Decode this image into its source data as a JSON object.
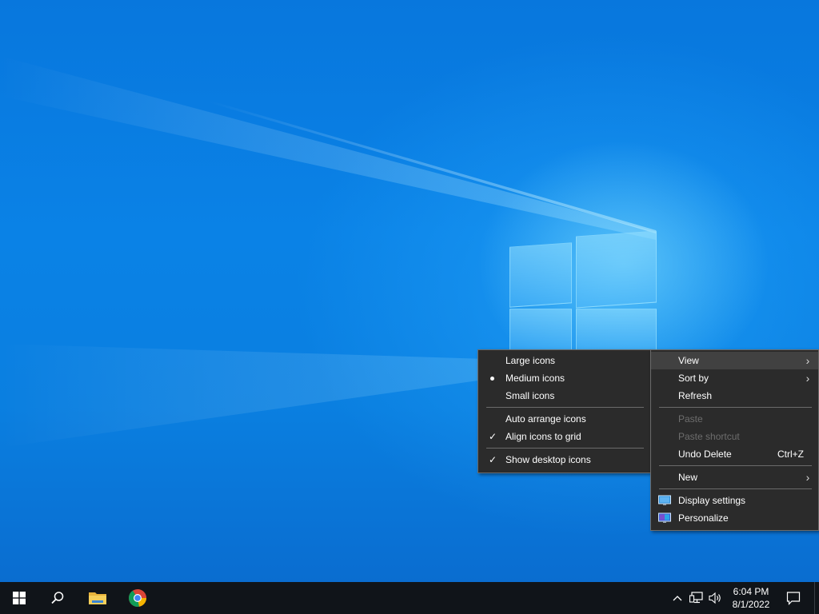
{
  "desktop": {
    "wallpaper": "windows-10-hero-wallpaper"
  },
  "view_submenu": {
    "items": [
      {
        "label": "Large icons",
        "mark": ""
      },
      {
        "label": "Medium icons",
        "mark": "bullet"
      },
      {
        "label": "Small icons",
        "mark": ""
      },
      {
        "label": "Auto arrange icons",
        "mark": ""
      },
      {
        "label": "Align icons to grid",
        "mark": "check"
      },
      {
        "label": "Show desktop icons",
        "mark": "check"
      }
    ],
    "check_glyph": "✓"
  },
  "context_menu": {
    "view": {
      "label": "View",
      "has_submenu": true,
      "highlighted": true
    },
    "sort_by": {
      "label": "Sort by",
      "has_submenu": true
    },
    "refresh": {
      "label": "Refresh"
    },
    "paste": {
      "label": "Paste",
      "enabled": false
    },
    "paste_shortcut": {
      "label": "Paste shortcut",
      "enabled": false
    },
    "undo_delete": {
      "label": "Undo Delete",
      "shortcut": "Ctrl+Z"
    },
    "new": {
      "label": "New",
      "has_submenu": true
    },
    "display_settings": {
      "label": "Display settings",
      "icon": "display-settings-icon"
    },
    "personalize": {
      "label": "Personalize",
      "icon": "personalize-icon"
    },
    "chevron_glyph": "›"
  },
  "taskbar": {
    "apps": [
      {
        "name": "start",
        "icon": "windows-logo-icon"
      },
      {
        "name": "search",
        "icon": "search-icon"
      },
      {
        "name": "file-explorer",
        "icon": "folder-icon"
      },
      {
        "name": "chrome",
        "icon": "chrome-icon"
      }
    ],
    "tray": {
      "chevron_glyph": "^",
      "network": "network-icon",
      "volume": "volume-icon"
    },
    "clock": {
      "time": "6:04 PM",
      "date": "8/1/2022"
    },
    "notifications": "action-center-icon"
  },
  "colors": {
    "menu_bg": "#2b2b2b",
    "menu_border": "#6b6b6b",
    "menu_hover": "#414141",
    "disabled_text": "#6d6d6d",
    "taskbar_bg": "#101419",
    "wallpaper_blue": "#0a7fe0"
  }
}
